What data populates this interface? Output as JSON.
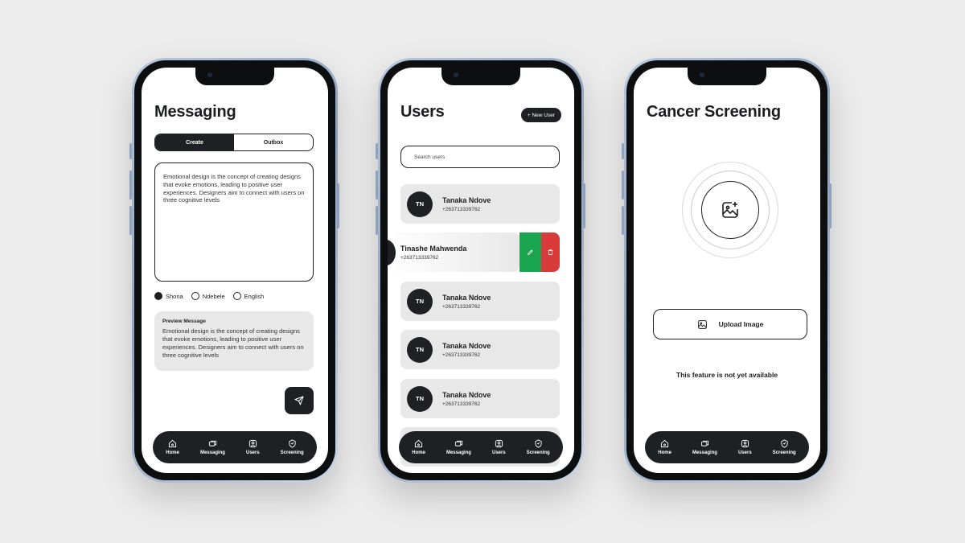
{
  "nav": {
    "home": "Home",
    "messaging": "Messaging",
    "users": "Users",
    "screening": "Screening"
  },
  "messaging": {
    "title": "Messaging",
    "tab_create": "Create",
    "tab_outbox": "Outbox",
    "message_text": "Emotional design is the concept of creating designs that evoke emotions, leading to positive user experiences. Designers aim to connect with users on three cognitive levels",
    "languages": [
      "Shona",
      "Ndebele",
      "English"
    ],
    "selected_language": "Shona",
    "preview_title": "Preview Message",
    "preview_text": "Emotional design is the concept of creating designs that evoke emotions, leading to positive user experiences. Designers aim to connect with users on three cognitive levels"
  },
  "users": {
    "title": "Users",
    "new_user_label": "+ New User",
    "search_placeholder": "Search users",
    "list": [
      {
        "initials": "TN",
        "name": "Tanaka Ndove",
        "phone": "+263713339762"
      },
      {
        "initials": "",
        "name": "Tinashe Mahwenda",
        "phone": "+263713339762"
      },
      {
        "initials": "TN",
        "name": "Tanaka Ndove",
        "phone": "+263713339762"
      },
      {
        "initials": "TN",
        "name": "Tanaka Ndove",
        "phone": "+263713339762"
      },
      {
        "initials": "TN",
        "name": "Tanaka Ndove",
        "phone": "+263713339762"
      }
    ],
    "colors": {
      "edit": "#1aa551",
      "delete": "#d93a3a"
    }
  },
  "screening": {
    "title": "Cancer Screening",
    "upload_label": "Upload Image",
    "unavailable_text": "This feature is not yet available"
  },
  "theme": {
    "dark": "#1f2023",
    "card": "#e8e8e9",
    "background": "#ececed"
  }
}
